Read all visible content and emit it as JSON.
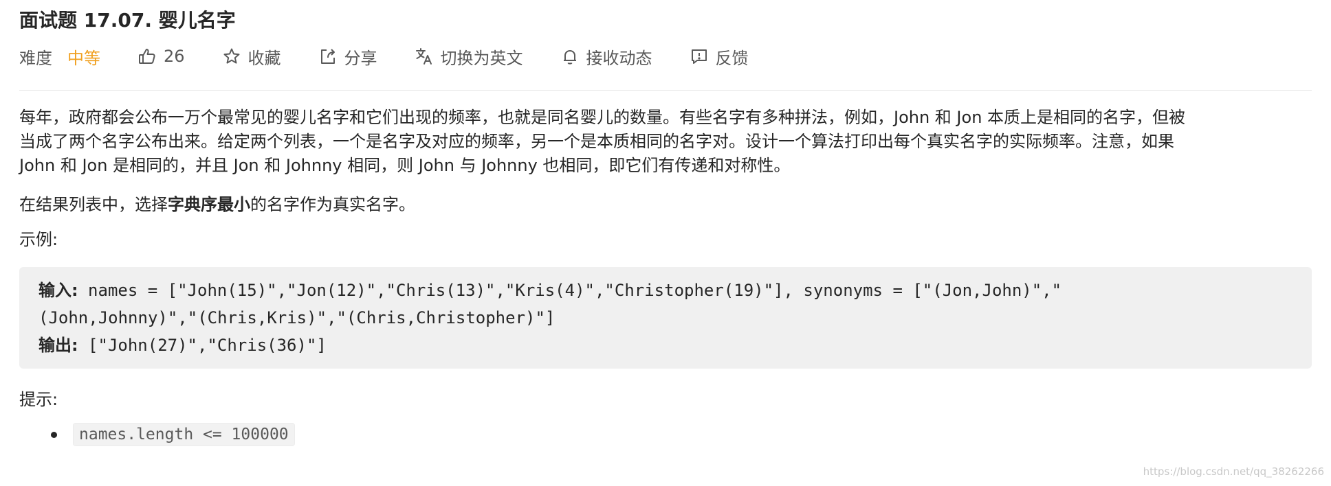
{
  "problem": {
    "title": "面试题 17.07. 婴儿名字"
  },
  "meta": {
    "difficulty_label": "难度",
    "difficulty_value": "中等",
    "likes": "26",
    "collect": "收藏",
    "share": "分享",
    "switch_lang": "切换为英文",
    "subscribe": "接收动态",
    "feedback": "反馈",
    "difficulty_color": "#f0a020"
  },
  "content": {
    "p1_line1": "每年，政府都会公布一万个最常见的婴儿名字和它们出现的频率，也就是同名婴儿的数量。有些名字有多种拼法，例如，John 和 Jon 本质上是相同的名字，但被",
    "p1_line2": "当成了两个名字公布出来。给定两个列表，一个是名字及对应的频率，另一个是本质相同的名字对。设计一个算法打印出每个真实名字的实际频率。注意，如果",
    "p1_line3": "John 和 Jon 是相同的，并且 Jon 和 Johnny 相同，则 John 与 Johnny 也相同，即它们有传递和对称性。",
    "p2_prefix": "在结果列表中，选择",
    "p2_bold": "字典序最小",
    "p2_suffix": "的名字作为真实名字。",
    "example_heading": "示例:",
    "example_input_label": "输入:",
    "example_input_line1": " names = [\"John(15)\",\"Jon(12)\",\"Chris(13)\",\"Kris(4)\",\"Christopher(19)\"], synonyms = [\"(Jon,John)\",\"",
    "example_input_line2": "(John,Johnny)\",\"(Chris,Kris)\",\"(Chris,Christopher)\"]",
    "example_output_label": "输出:",
    "example_output_value": " [\"John(27)\",\"Chris(36)\"]",
    "hint_heading": "提示:",
    "hints": [
      "names.length <= 100000"
    ]
  },
  "watermark": "https://blog.csdn.net/qq_38262266"
}
